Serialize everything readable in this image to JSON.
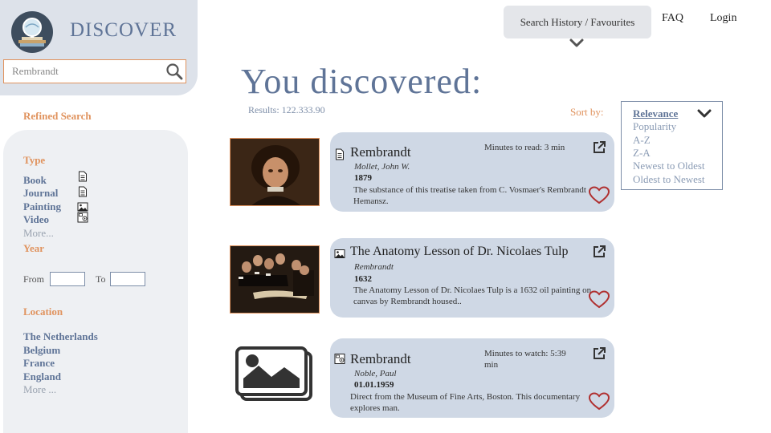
{
  "brand": {
    "title": "DISCOVER"
  },
  "search": {
    "value": "Rembrandt"
  },
  "nav": {
    "history_label": "Search History / Favourites",
    "faq": "FAQ",
    "login": "Login"
  },
  "refined": {
    "label": "Refined Search",
    "type": {
      "heading": "Type",
      "items": [
        "Book",
        "Journal",
        "Painting",
        "Video"
      ],
      "icons": [
        "document-icon",
        "document-icon",
        "image-icon",
        "video-icon"
      ],
      "more": "More..."
    },
    "year": {
      "heading": "Year",
      "from_label": "From",
      "to_label": "To",
      "from_value": "",
      "to_value": ""
    },
    "location": {
      "heading": "Location",
      "items": [
        "The Netherlands",
        "Belgium",
        "France",
        "England"
      ],
      "more": "More ..."
    }
  },
  "main": {
    "title": "You discovered:",
    "results": "Results: 122.333.90"
  },
  "sort": {
    "label": "Sort by:",
    "options": [
      "Relevance",
      "Popularity",
      "A-Z",
      "Z-A",
      "Newest to Oldest",
      "Oldest to Newest"
    ],
    "selected": "Relevance"
  },
  "results": [
    {
      "type_icon": "document-icon",
      "title": "Rembrandt",
      "author": "Mollet, John W.",
      "date": "1879",
      "meta": "Minutes to read: 3 min",
      "description": "The substance of this treatise taken from C. Vosmaer's Rembrandt Hemansz.",
      "thumbnail": "portrait-painting"
    },
    {
      "type_icon": "image-icon",
      "title": "The Anatomy Lesson of Dr. Nicolaes Tulp",
      "author": "Rembrandt",
      "date": "1632",
      "meta": "",
      "description": "The Anatomy Lesson of Dr. Nicolaes Tulp is a 1632 oil painting on canvas by Rembrandt housed..",
      "thumbnail": "anatomy-lesson-painting"
    },
    {
      "type_icon": "video-icon",
      "title": "Rembrandt",
      "author": "Noble, Paul",
      "date": "01.01.1959",
      "meta": "Minutes to watch: 5:39 min",
      "description": "Direct from the Museum of Fine Arts, Boston. This documentary explores man.",
      "thumbnail": "image-placeholder"
    }
  ],
  "colors": {
    "brand": "#5f7497",
    "accent": "#e0935e",
    "card": "#cfd8e5",
    "heart": "#b03030"
  }
}
